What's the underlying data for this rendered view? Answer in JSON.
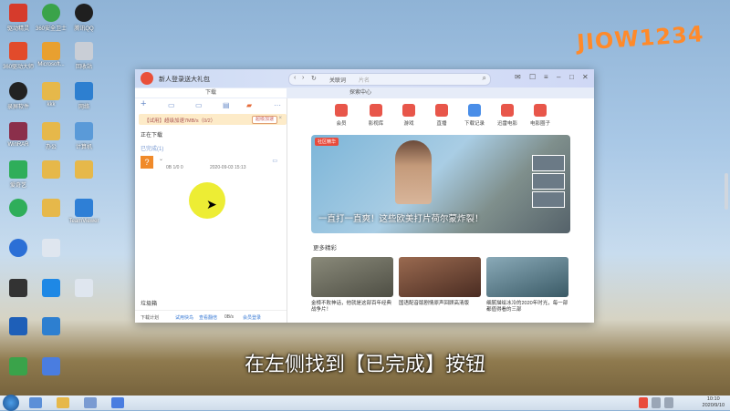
{
  "desktop": {
    "icons": [
      {
        "label": "驱动精灵",
        "color": "#d63b2c"
      },
      {
        "label": "360安全卫士",
        "color": "#3aa34a"
      },
      {
        "label": "腾讯QQ",
        "color": "#1f1f1f"
      },
      {
        "label": "360驱动大师",
        "color": "#e24b2b"
      },
      {
        "label": "Microsoft...",
        "color": "#e8a030"
      },
      {
        "label": "回收站",
        "color": "#c9ced6"
      },
      {
        "label": "录屏软件",
        "color": "#222"
      },
      {
        "label": "kkk",
        "color": "#e6b84a"
      },
      {
        "label": "网络",
        "color": "#2d7fd0"
      },
      {
        "label": "WinRAR",
        "color": "#8b2f4b"
      },
      {
        "label": "办公",
        "color": "#e6b84a"
      },
      {
        "label": "计算机",
        "color": "#5a9ad8"
      },
      {
        "label": "爱奇艺",
        "color": "#2fae5a"
      },
      {
        "label": "",
        "color": "#e6b84a"
      },
      {
        "label": "",
        "color": "#e6b84a"
      },
      {
        "label": "",
        "color": "#2fae5a"
      },
      {
        "label": "",
        "color": "#e6b84a"
      },
      {
        "label": "TeamViewer",
        "color": "#2e7fd6"
      }
    ],
    "watermark": "JIOW1234"
  },
  "window": {
    "title": "新人登录送大礼包",
    "url_tab_text": "关联词",
    "url_placeholder": "片名",
    "tabs": [
      "下载",
      "探索中心"
    ],
    "left": {
      "banner_text": "【试用】超级加速7MB/s（0/2）",
      "banner_button": "超级加速",
      "downloading": "正在下载",
      "completed": "已完成(1)",
      "item_meta": "0B 1/0 0",
      "item_time": "2020-09-03 15:13",
      "trash": "垃圾箱",
      "footer": [
        "下载计划",
        "试用快鸟",
        "查看翻倍",
        "0B/s",
        "会员登录"
      ]
    },
    "right": {
      "nav": [
        {
          "label": "会员",
          "color": "#e8564a"
        },
        {
          "label": "影视库",
          "color": "#e8564a"
        },
        {
          "label": "游戏",
          "color": "#e8564a"
        },
        {
          "label": "直播",
          "color": "#e8564a"
        },
        {
          "label": "下载记录",
          "color": "#4a8ee8"
        },
        {
          "label": "迅雷电影",
          "color": "#e8564a"
        },
        {
          "label": "电影圈子",
          "color": "#e8564a"
        }
      ],
      "hero_tag": "社区精华",
      "hero_caption": "一直打一直爽！这些欧美打片荷尔蒙炸裂！",
      "more_label": "更多精彩",
      "cards": [
        {
          "title": "金榜不败神话，他就是这部百年经典战争片！",
          "color": "#6a6a5a"
        },
        {
          "title": "国语配音版剧情原声回顾高清版",
          "color": "#7a5040"
        },
        {
          "title": "细腻描绘冰冷的2020年时光，每一部都值得看的三部",
          "color": "#5a7a8a"
        }
      ]
    }
  },
  "subtitle": "在左侧找到【已完成】按钮",
  "taskbar": {
    "time": "10:10",
    "date": "2020/9/10"
  }
}
